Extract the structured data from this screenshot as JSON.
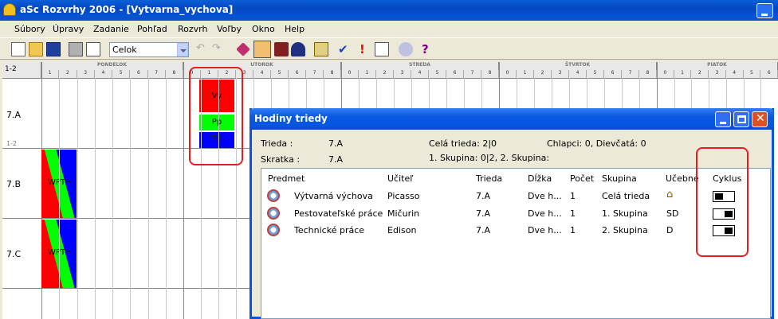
{
  "window": {
    "title": "aSc Rozvrhy 2006  - [Vytvarna_vychova]"
  },
  "menu": [
    "Súbory",
    "Úpravy",
    "Zadanie",
    "Pohľad",
    "Rozvrh",
    "Voľby",
    "Okno",
    "Help"
  ],
  "toolbar": {
    "combo_value": "Celok"
  },
  "grid": {
    "corner_label": "1-2",
    "days": [
      "PONDELOK",
      "UTOROK",
      "STREDA",
      "ŠTVRTOK",
      "PIATOK"
    ],
    "slots": [
      "0",
      "1",
      "2",
      "3",
      "4",
      "5",
      "6",
      "7",
      "8"
    ],
    "rows": [
      {
        "label": "7.A",
        "sub": "1-2"
      },
      {
        "label": "7.B"
      },
      {
        "label": "7.C"
      }
    ],
    "cards": {
      "vv": "Vv",
      "pp": "Pp",
      "tp": "Tp",
      "wptp_b": "WPTP",
      "wptp_c": "WPTP"
    },
    "colors": {
      "red": "#ff0000",
      "green": "#00ff00",
      "blue": "#0000ff"
    }
  },
  "dialog": {
    "title": "Hodiny triedy",
    "trieda_label": "Trieda :",
    "trieda_value": "7.A",
    "skratka_label": "Skratka :",
    "skratka_value": "7.A",
    "cela_trieda": "Celá trieda: 2|0",
    "skupiny": "1. Skupina: 0|2, 2. Skupina:",
    "chlapci": "Chlapci: 0, Dievčatá: 0",
    "columns": [
      "Predmet",
      "Učiteľ",
      "Trieda",
      "Dĺžka",
      "Počet",
      "Skupina",
      "Učebne",
      "Cyklus"
    ],
    "rows": [
      {
        "predmet": "Výtvarná výchova",
        "ucitel": "Picasso",
        "trieda": "7.A",
        "dlzka": "Dve h...",
        "pocet": "1",
        "skupina": "Celá trieda",
        "ucebne": "",
        "ucebne_icon": "house-icon",
        "cyklus": [
          1,
          0
        ]
      },
      {
        "predmet": "Pestovateľské práce",
        "ucitel": "Mičurin",
        "trieda": "7.A",
        "dlzka": "Dve h...",
        "pocet": "1",
        "skupina": "1. Skupina",
        "ucebne": "SD",
        "cyklus": [
          0,
          1
        ]
      },
      {
        "predmet": "Technické práce",
        "ucitel": "Edison",
        "trieda": "7.A",
        "dlzka": "Dve h...",
        "pocet": "1",
        "skupina": "2. Skupina",
        "ucebne": "D",
        "cyklus": [
          0,
          1
        ]
      }
    ]
  }
}
